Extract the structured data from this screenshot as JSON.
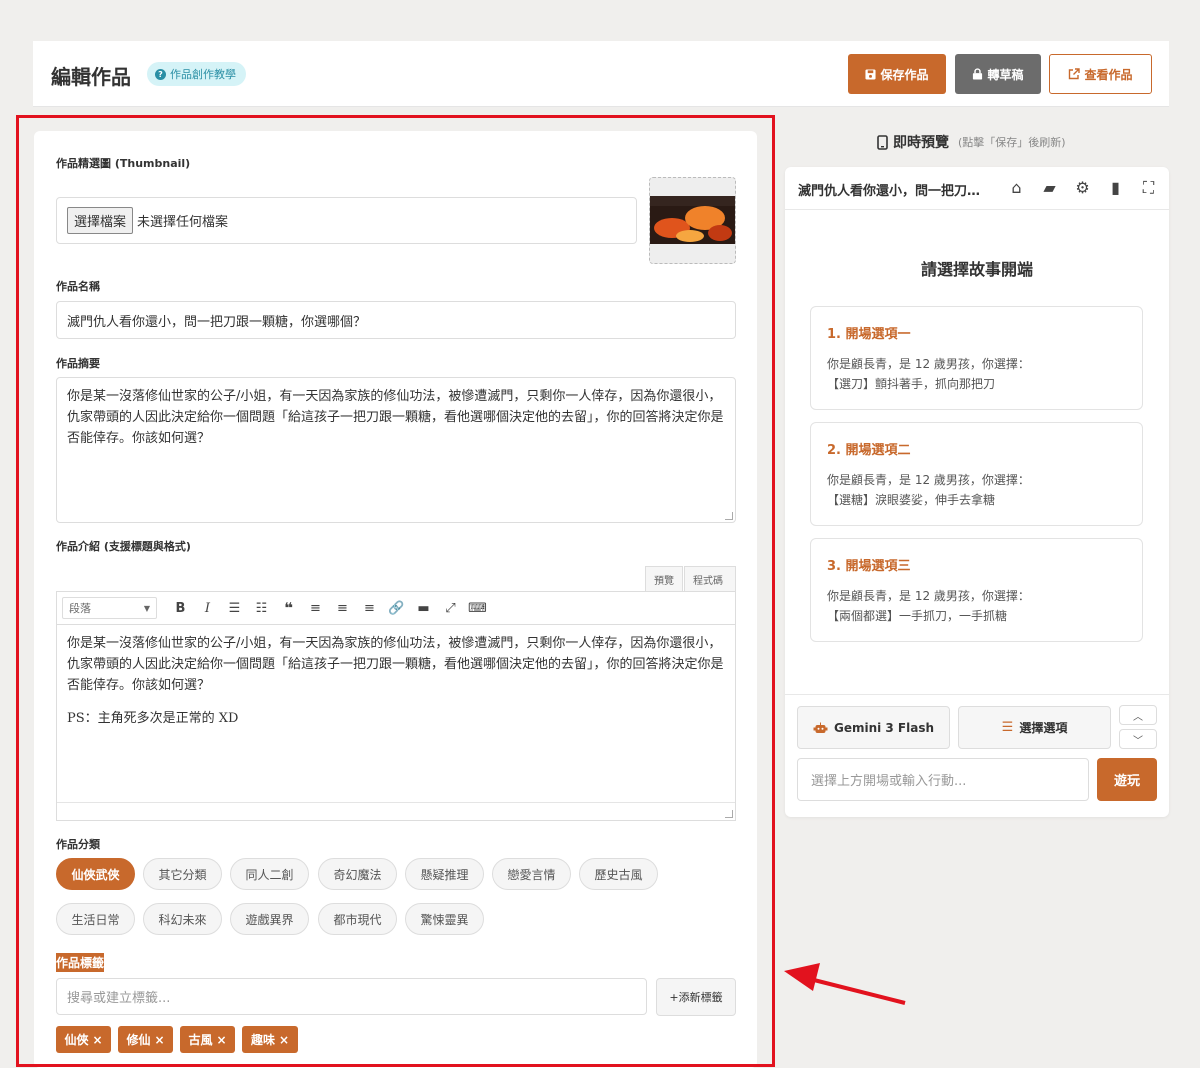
{
  "header": {
    "title": "編輯作品",
    "help_badge": "作品創作教學",
    "save_label": "保存作品",
    "draft_label": "轉草稿",
    "view_label": "查看作品"
  },
  "form": {
    "thumbnail_label": "作品精選圖 (Thumbnail)",
    "file_button": "選擇檔案",
    "file_status": "未選擇任何檔案",
    "name_label": "作品名稱",
    "name_value": "滅門仇人看你還小，問一把刀跟一顆糖，你選哪個？",
    "summary_label": "作品摘要",
    "summary_value": "你是某一沒落修仙世家的公子/小姐，有一天因為家族的修仙功法，被慘遭滅門，只剩你一人倖存，因為你還很小，仇家帶頭的人因此決定給你一個問題「給這孩子一把刀跟一顆糖，看他選哪個決定他的去留」，你的回答將決定你是否能倖存。你該如何選？",
    "intro_label": "作品介紹 (支援標題與格式)",
    "tab_preview": "預覽",
    "tab_code": "程式碼",
    "format_select": "段落",
    "intro_paragraph_1": "你是某一沒落修仙世家的公子/小姐，有一天因為家族的修仙功法，被慘遭滅門，只剩你一人倖存，因為你還很小，仇家帶頭的人因此決定給你一個問題「給這孩子一把刀跟一顆糖，看他選哪個決定他的去留」，你的回答將決定你是否能倖存。你該如何選？",
    "intro_paragraph_2": "PS：主角死多次是正常的 XD",
    "category_label": "作品分類",
    "categories": [
      "仙俠武俠",
      "其它分類",
      "同人二創",
      "奇幻魔法",
      "懸疑推理",
      "戀愛言情",
      "歷史古風",
      "生活日常",
      "科幻未來",
      "遊戲異界",
      "都市現代",
      "驚悚靈異"
    ],
    "active_category": "仙俠武俠",
    "tag_label": "作品標籤",
    "tag_placeholder": "搜尋或建立標籤...",
    "add_tag_label": "+添新標籤",
    "tags": [
      "仙俠",
      "修仙",
      "古風",
      "趣味"
    ],
    "tag_remove_glyph": "×"
  },
  "preview": {
    "heading": "即時預覽",
    "heading_note": "(點擊「保存」後刷新)",
    "story_title": "滅門仇人看你還小，問一把刀…",
    "choose_title": "請選擇故事開端",
    "options": [
      {
        "title": "1. 開場選項一",
        "line1": "你是顧長青，是 12 歲男孩，你選擇：",
        "line2": "【選刀】顫抖著手，抓向那把刀"
      },
      {
        "title": "2. 開場選項二",
        "line1": "你是顧長青，是 12 歲男孩，你選擇：",
        "line2": "【選糖】淚眼婆娑，伸手去拿糖"
      },
      {
        "title": "3. 開場選項三",
        "line1": "你是顧長青，是 12 歲男孩，你選擇：",
        "line2": "【兩個都選】一手抓刀，一手抓糖"
      }
    ],
    "model_label": "Gemini 3 Flash",
    "options_button": "選擇選項",
    "input_placeholder": "選擇上方開場或輸入行動...",
    "play_label": "遊玩"
  },
  "icons": {
    "save": "floppy-icon",
    "lock": "lock-icon",
    "external": "external-link-icon",
    "mobile": "mobile-icon",
    "home": "home-icon",
    "folder": "folder-icon",
    "gear": "gear-icon",
    "book": "book-icon",
    "expand": "expand-icon",
    "robot": "robot-icon",
    "list": "list-icon"
  },
  "colors": {
    "accent": "#c8692c",
    "highlight_frame": "#e2121e",
    "draft_button": "#6c6c6c",
    "help_badge_bg": "#d5f3f7"
  }
}
